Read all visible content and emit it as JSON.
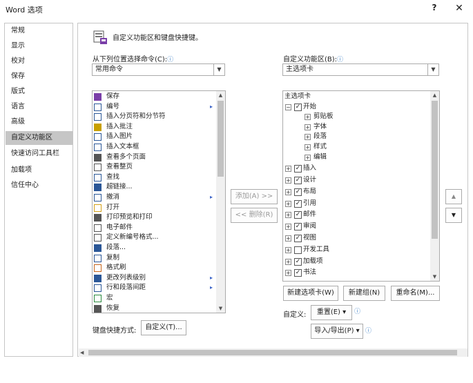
{
  "window": {
    "title": "Word 选项",
    "help": "?",
    "close": "✕"
  },
  "nav": {
    "items": [
      "常规",
      "显示",
      "校对",
      "保存",
      "版式",
      "语言",
      "高级",
      "自定义功能区",
      "快速访问工具栏",
      "加载项",
      "信任中心"
    ],
    "selected": "自定义功能区"
  },
  "header": {
    "text": "自定义功能区和键盘快捷键。"
  },
  "left_panel": {
    "label": "从下列位置选择命令(C):",
    "combo_value": "常用命令",
    "commands": [
      "保存",
      "编号",
      "插入分页符和分节符",
      "插入批注",
      "插入图片",
      "插入文本框",
      "查看多个页面",
      "查看整页",
      "查找",
      "超链接...",
      "撤消",
      "打开",
      "打印预览和打印",
      "电子邮件",
      "定义新编号格式...",
      "段落...",
      "复制",
      "格式刷",
      "更改列表级别",
      "行和段落间距",
      "宏",
      "恢复"
    ],
    "submenu_marker": "▸"
  },
  "middle": {
    "add": "添加(A) >>",
    "remove": "<< 删除(R)"
  },
  "right_panel": {
    "label": "自定义功能区(B):",
    "combo_value": "主选项卡",
    "tree_header": "主选项卡",
    "tree": {
      "root": "开始",
      "root_children": [
        "剪贴板",
        "字体",
        "段落",
        "样式",
        "编辑"
      ],
      "tabs": [
        {
          "label": "插入",
          "checked": true
        },
        {
          "label": "设计",
          "checked": true
        },
        {
          "label": "布局",
          "checked": true
        },
        {
          "label": "引用",
          "checked": true
        },
        {
          "label": "邮件",
          "checked": true
        },
        {
          "label": "审阅",
          "checked": true
        },
        {
          "label": "视图",
          "checked": true
        },
        {
          "label": "开发工具",
          "checked": false
        },
        {
          "label": "加载项",
          "checked": true
        },
        {
          "label": "书法",
          "checked": true
        }
      ]
    },
    "new_tab": "新建选项卡(W)",
    "new_group": "新建组(N)",
    "rename": "重命名(M)...",
    "customize_label": "自定义:",
    "reset": "重置(E) ▾",
    "import_export": "导入/导出(P) ▾",
    "move_up": "▲",
    "move_down": "▼"
  },
  "keyboard": {
    "label": "键盘快捷方式:",
    "button": "自定义(T)..."
  },
  "info_icon": "ⓘ",
  "expand_plus": "+",
  "expand_minus": "−",
  "check_mark": "✓",
  "colors": {
    "accent": "#3b7fc4",
    "selected_nav": "#c6c6c6",
    "border": "#ababab"
  },
  "watermark": {
    "site": "jb51.net",
    "name": "脚本之家"
  }
}
